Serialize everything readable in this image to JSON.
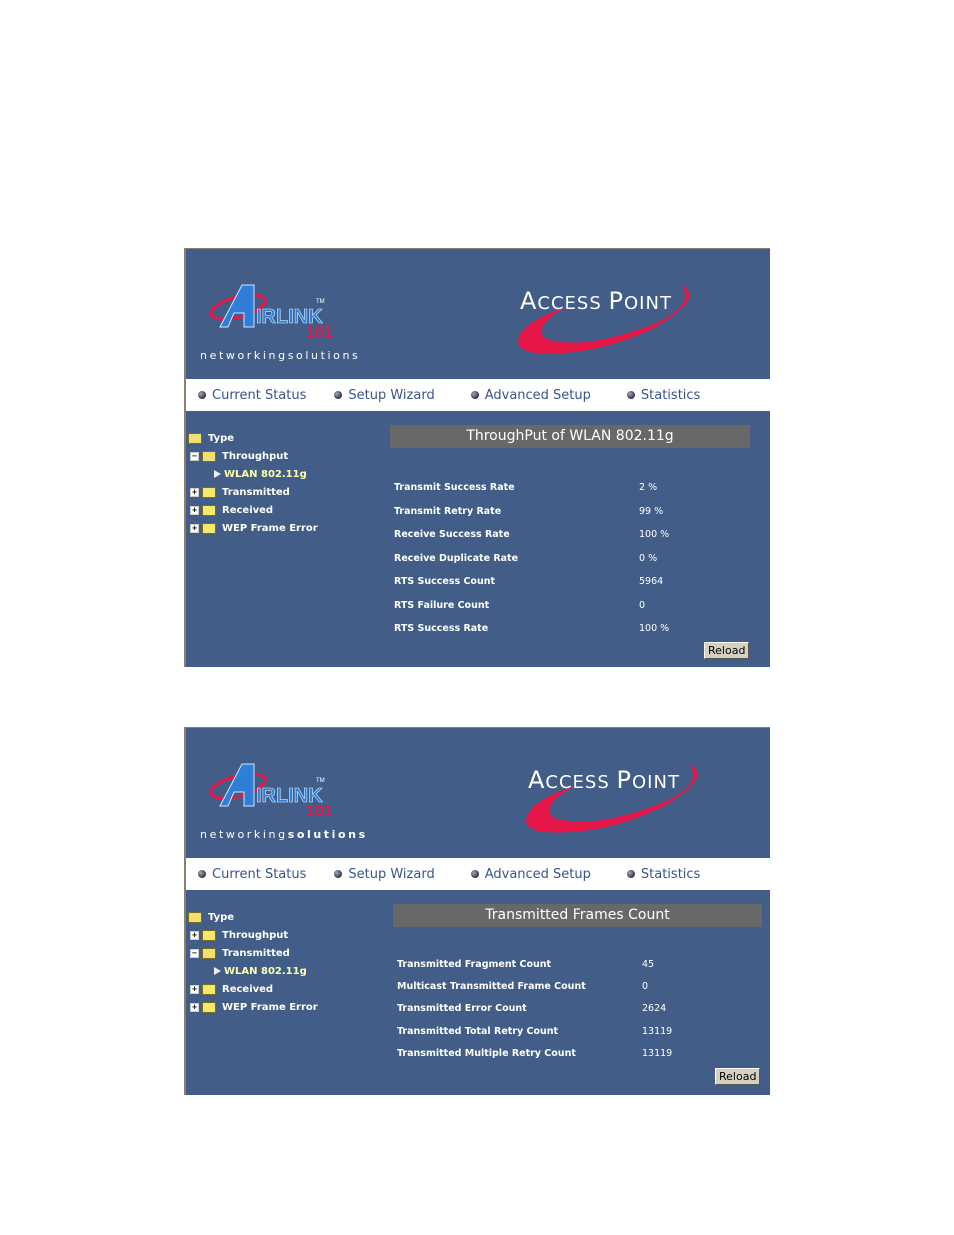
{
  "brand": {
    "logo_text": "AIRLINK",
    "logo_number": "101",
    "tagline_a": "networking",
    "tagline_b": "solutions",
    "product_title_a": "A",
    "product_title_b": "CCESS ",
    "product_title_c": "P",
    "product_title_d": "OINT"
  },
  "nav": [
    {
      "label": "Current Status"
    },
    {
      "label": "Setup Wizard"
    },
    {
      "label": "Advanced Setup"
    },
    {
      "label": "Statistics"
    }
  ],
  "panel1": {
    "tree": {
      "root": "Type",
      "items": [
        "Throughput",
        "WLAN 802.11g",
        "Transmitted",
        "Received",
        "WEP Frame Error"
      ]
    },
    "title": "ThroughPut of WLAN 802.11g",
    "rows": [
      {
        "label": "Transmit Success Rate",
        "value": "2  %"
      },
      {
        "label": "Transmit Retry Rate",
        "value": "99  %"
      },
      {
        "label": "Receive Success Rate",
        "value": "100  %"
      },
      {
        "label": "Receive Duplicate Rate",
        "value": "0  %"
      },
      {
        "label": "RTS Success Count",
        "value": "5964"
      },
      {
        "label": "RTS Failure Count",
        "value": "0"
      },
      {
        "label": "RTS Success Rate",
        "value": "100  %"
      }
    ],
    "reload_label": "Reload"
  },
  "panel2": {
    "tree": {
      "root": "Type",
      "items": [
        "Throughput",
        "Transmitted",
        "WLAN 802.11g",
        "Received",
        "WEP Frame Error"
      ]
    },
    "title": "Transmitted Frames Count",
    "rows": [
      {
        "label": "Transmitted Fragment Count",
        "value": "45"
      },
      {
        "label": "Multicast Transmitted Frame Count",
        "value": "0"
      },
      {
        "label": "Transmitted Error Count",
        "value": "2624"
      },
      {
        "label": "Transmitted Total Retry Count",
        "value": "13119"
      },
      {
        "label": "Transmitted Multiple Retry Count",
        "value": "13119"
      }
    ],
    "reload_label": "Reload"
  },
  "colors": {
    "panel_bg": "#425d88",
    "title_bar": "#686868",
    "accent_red": "#e8174a"
  }
}
